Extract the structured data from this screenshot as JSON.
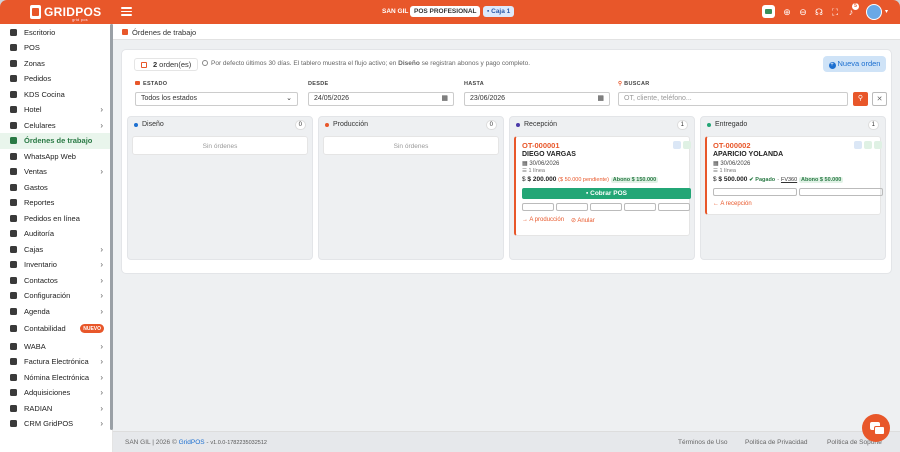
{
  "app": {
    "brand": "GRIDPOS",
    "brand_sub": "grid pos"
  },
  "topbar": {
    "branch": "SAN GIL",
    "pos_label": "POS PROFESIONAL",
    "caja_label": "Caja 1",
    "notifications": "5"
  },
  "sidebar": {
    "items": [
      {
        "label": "Escritorio",
        "icon": "desktop-icon",
        "arrow": false
      },
      {
        "label": "POS",
        "icon": "pos-icon",
        "arrow": false
      },
      {
        "label": "Zonas",
        "icon": "map-pin-icon",
        "arrow": false
      },
      {
        "label": "Pedidos",
        "icon": "cart-icon",
        "arrow": false
      },
      {
        "label": "KDS Cocina",
        "icon": "utensils-icon",
        "arrow": false
      },
      {
        "label": "Hotel",
        "icon": "bed-icon",
        "arrow": true
      },
      {
        "label": "Celulares",
        "icon": "phone-icon",
        "arrow": true
      },
      {
        "label": "Órdenes de trabajo",
        "icon": "clipboard-icon",
        "arrow": false,
        "active": true
      },
      {
        "label": "WhatsApp Web",
        "icon": "whatsapp-icon",
        "arrow": false
      },
      {
        "label": "Ventas",
        "icon": "cart-icon",
        "arrow": true
      },
      {
        "label": "Gastos",
        "icon": "wallet-icon",
        "arrow": false
      },
      {
        "label": "Reportes",
        "icon": "chart-icon",
        "arrow": false
      },
      {
        "label": "Pedidos en línea",
        "icon": "globe-icon",
        "arrow": false
      },
      {
        "label": "Auditoría",
        "icon": "shield-icon",
        "arrow": false
      },
      {
        "label": "Cajas",
        "icon": "cash-register-icon",
        "arrow": true
      },
      {
        "label": "Inventario",
        "icon": "box-icon",
        "arrow": true
      },
      {
        "label": "Contactos",
        "icon": "users-icon",
        "arrow": true
      },
      {
        "label": "Configuración",
        "icon": "gear-icon",
        "arrow": true
      },
      {
        "label": "Agenda",
        "icon": "calendar-icon",
        "arrow": true
      },
      {
        "label": "Contabilidad",
        "icon": "grid-icon",
        "arrow": false,
        "badge": "NUEVO",
        "gap": true
      },
      {
        "label": "WABA",
        "icon": "whatsapp-icon",
        "arrow": true,
        "gap": true
      },
      {
        "label": "Factura Electrónica",
        "icon": "invoice-icon",
        "arrow": true
      },
      {
        "label": "Nómina Electrónica",
        "icon": "payroll-icon",
        "arrow": true
      },
      {
        "label": "Adquisiciones",
        "icon": "bag-icon",
        "arrow": true
      },
      {
        "label": "RADIAN",
        "icon": "code-icon",
        "arrow": true
      },
      {
        "label": "CRM GridPOS",
        "icon": "user-icon",
        "arrow": true
      }
    ]
  },
  "breadcrumb": {
    "title": "Órdenes de trabajo"
  },
  "toolbar": {
    "count": "2",
    "count_label": "orden(es)",
    "hint_pre": "Por defecto últimos 30 días. El tablero muestra el flujo activo; en ",
    "hint_bold": "Diseño",
    "hint_post": " se registran abonos y pago completo.",
    "new_label": "Nueva orden"
  },
  "filters": {
    "estado_label": "ESTADO",
    "estado_value": "Todos los estados",
    "desde_label": "DESDE",
    "desde_value": "24/05/2026",
    "hasta_label": "HASTA",
    "hasta_value": "23/06/2026",
    "buscar_label": "BUSCAR",
    "buscar_placeholder": "OT, cliente, teléfono..."
  },
  "columns": [
    {
      "title": "Diseño",
      "count": "0",
      "dot": "#1c6fd0",
      "empty": "Sin órdenes"
    },
    {
      "title": "Producción",
      "count": "0",
      "dot": "#e8572a",
      "empty": "Sin órdenes"
    },
    {
      "title": "Recepción",
      "count": "1",
      "dot": "#4b3aa8"
    },
    {
      "title": "Entregado",
      "count": "1",
      "dot": "#23a676"
    }
  ],
  "orders": [
    {
      "ot": "OT-000001",
      "client": "DIEGO VARGAS",
      "date": "30/06/2026",
      "lines": "1 línea",
      "amount": "$ 200.000",
      "pending": "($ 50.000 pendiente)",
      "abono": "Abono $ 150.000",
      "cobrar": "Cobrar POS",
      "forward": "A producción",
      "cancel": "Anular"
    },
    {
      "ot": "OT-000002",
      "client": "APARICIO YOLANDA",
      "date": "30/06/2026",
      "lines": "1 línea",
      "amount": "$ 500.000",
      "paid": "Pagado",
      "fv": "FV360",
      "abono": "Abono $ 50.000",
      "back": "A recepción"
    }
  ],
  "footer": {
    "left_text": "SAN GIL | 2026 ©",
    "brand": "GridPOS",
    "version": "v1.0.0-1782235032512",
    "links": [
      "Términos de Uso",
      "Política de Privacidad",
      "Política de Soporte"
    ]
  }
}
